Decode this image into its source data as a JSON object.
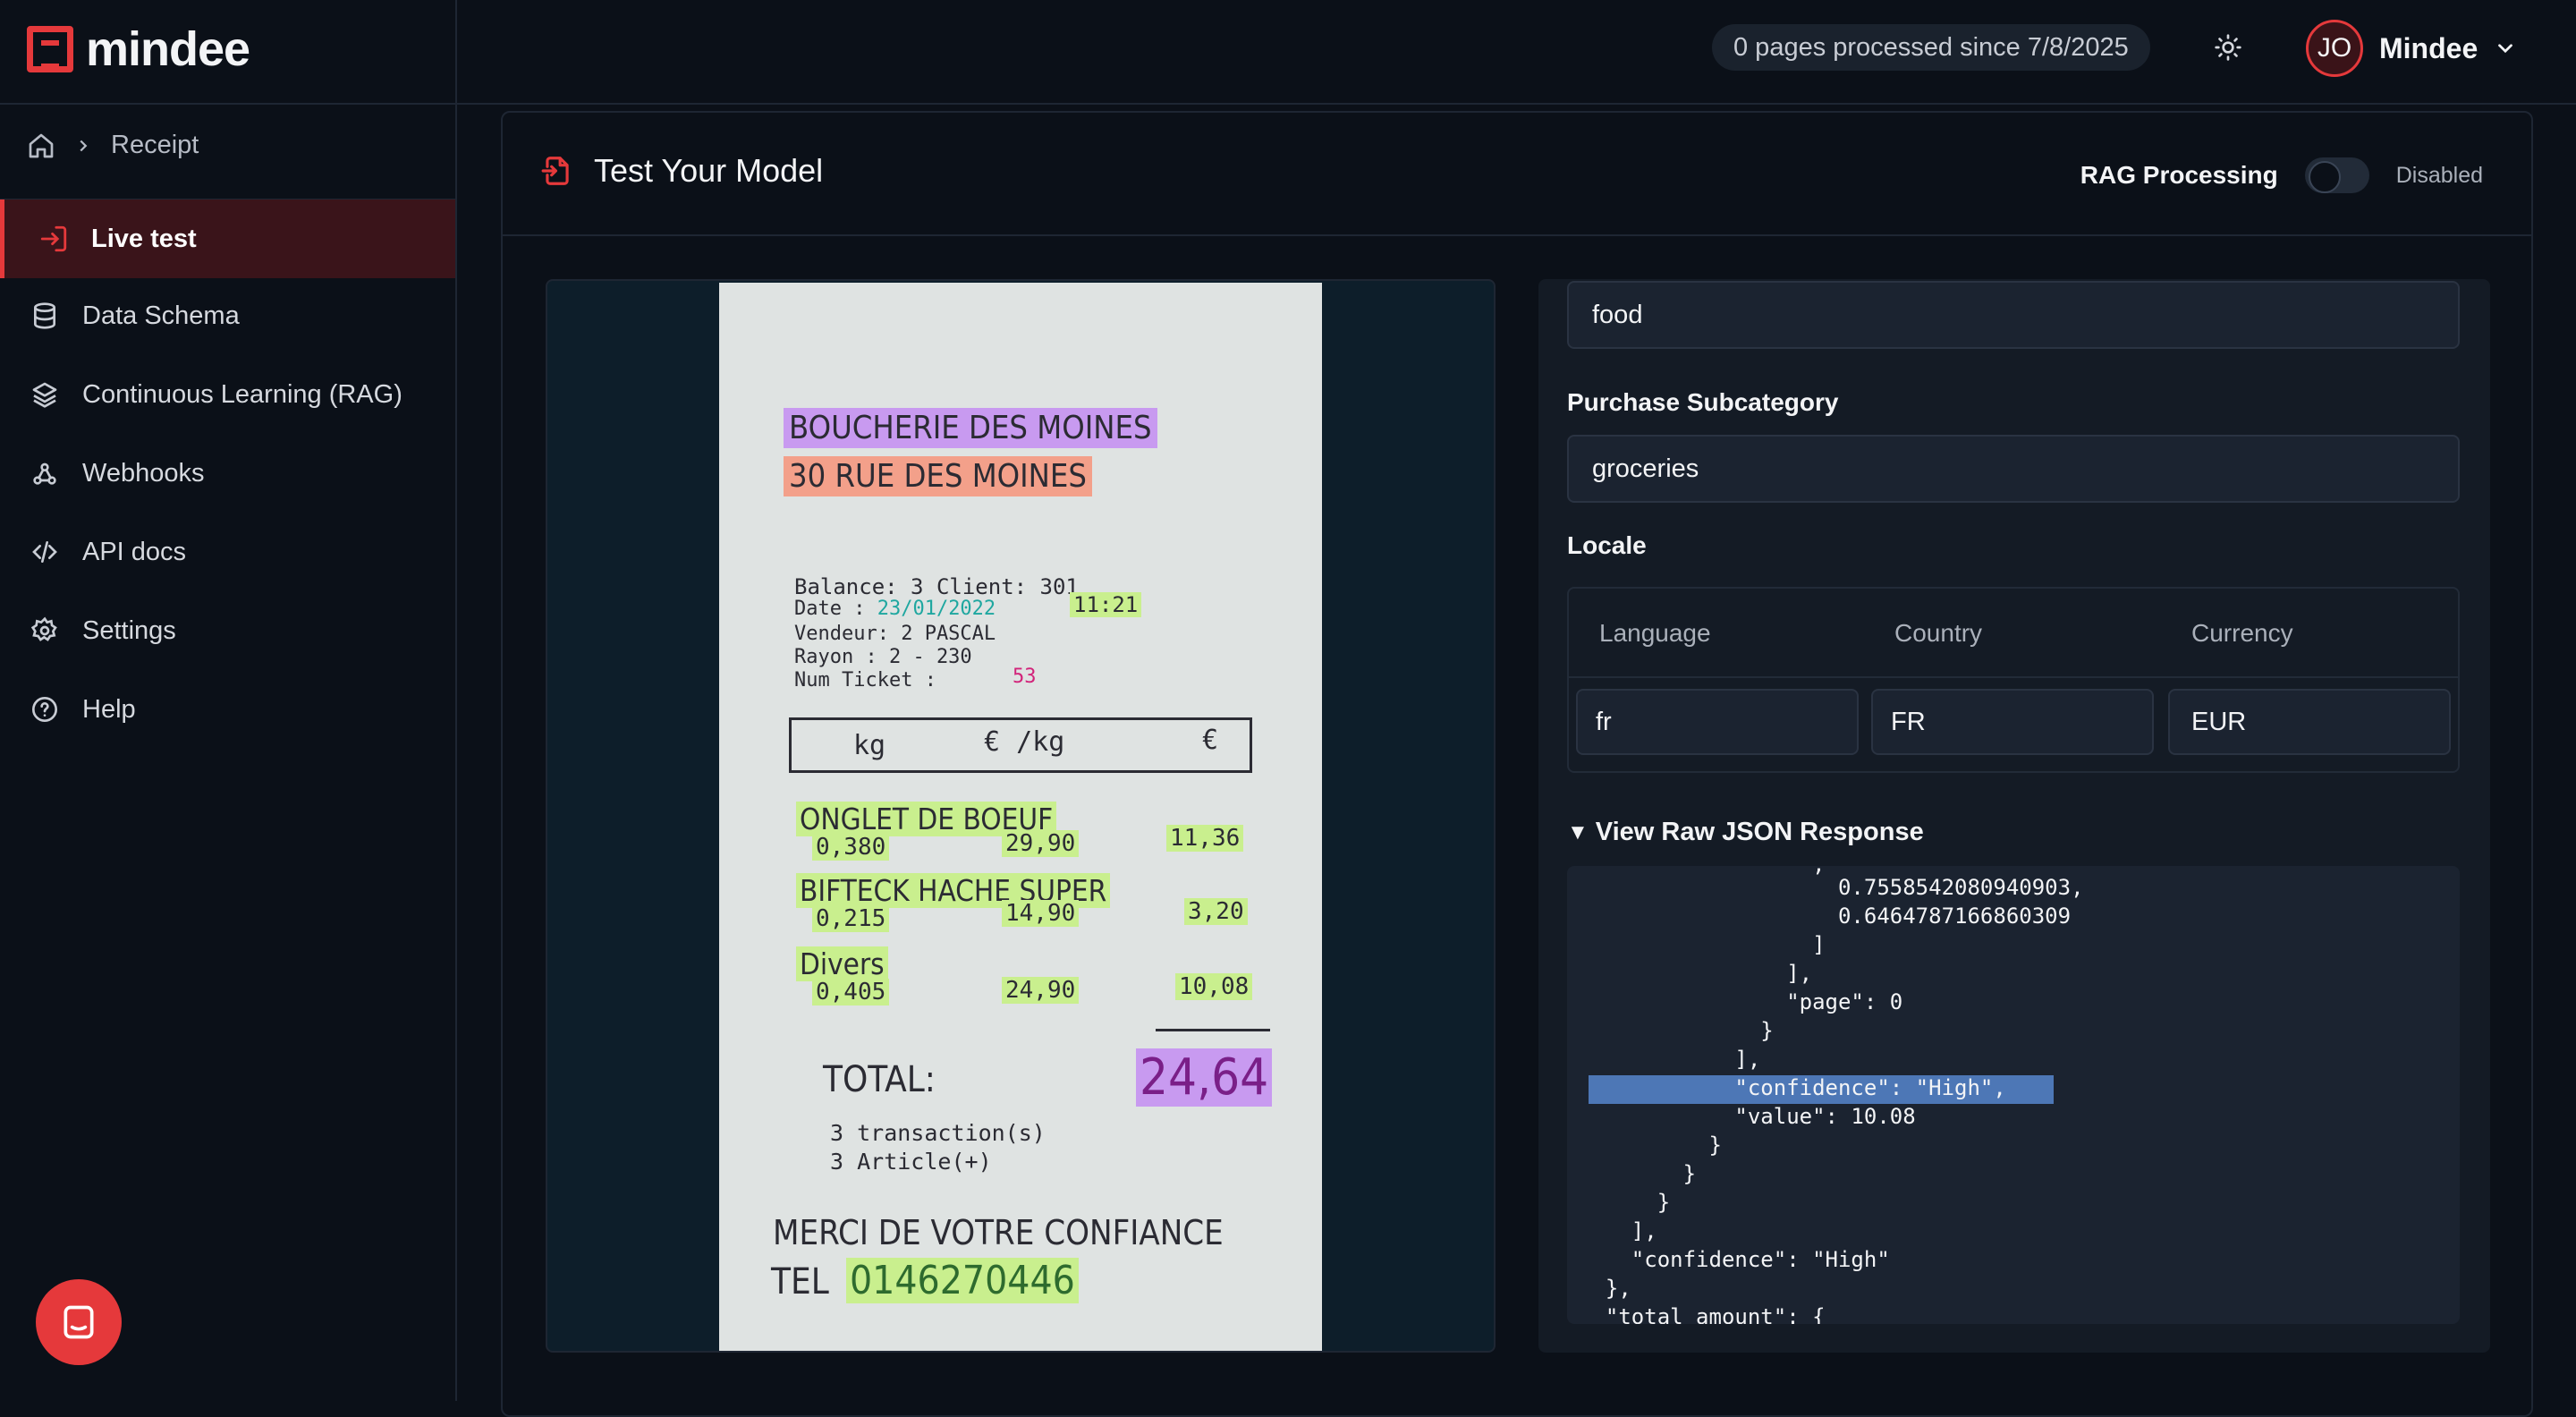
{
  "brand": {
    "name": "mindee",
    "accent": "#e5393b"
  },
  "header": {
    "pages_processed": "0 pages processed since 7/8/2025",
    "user_initials": "JO",
    "user_name": "Mindee"
  },
  "breadcrumb": {
    "current": "Receipt"
  },
  "sidebar": {
    "items": [
      {
        "label": "Live test",
        "icon": "login-arrow-icon",
        "active": true
      },
      {
        "label": "Data Schema",
        "icon": "database-icon"
      },
      {
        "label": "Continuous Learning (RAG)",
        "icon": "layers-icon"
      },
      {
        "label": "Webhooks",
        "icon": "webhook-icon"
      },
      {
        "label": "API docs",
        "icon": "code-icon"
      },
      {
        "label": "Settings",
        "icon": "gear-icon"
      },
      {
        "label": "Help",
        "icon": "help-circle-icon"
      }
    ]
  },
  "panel": {
    "title": "Test Your Model",
    "rag_label": "RAG Processing",
    "rag_state": "Disabled"
  },
  "receipt": {
    "store": "BOUCHERIE DES MOINES",
    "address": "30 RUE DES MOINES",
    "balance_line": "Balance:  3   Client:  301",
    "date_prefix": "Date : ",
    "date": "23/01/2022",
    "time": "11:21",
    "vendeur_line": "Vendeur:  2  PASCAL",
    "rayon_line": "Rayon   :  2  -  230",
    "ticket_prefix": "Num Ticket :",
    "ticket": "53",
    "col_kg": "kg",
    "col_price": "€ /kg",
    "col_eur": "€",
    "items": [
      {
        "name": "ONGLET DE BOEUF",
        "qty": "0,380",
        "unit": "29,90",
        "total": "11,36"
      },
      {
        "name": "BIFTECK HACHE SUPER",
        "qty": "0,215",
        "unit": "14,90",
        "total": "3,20"
      },
      {
        "name": "Divers",
        "qty": "0,405",
        "unit": "24,90",
        "total": "10,08"
      }
    ],
    "total_label": "TOTAL:",
    "total": "24,64",
    "transactions": "3 transaction(s)",
    "articles": "3 Article(+)",
    "thanks": "MERCI DE VOTRE CONFIANCE",
    "tel_prefix": "TEL",
    "tel": "0146270446"
  },
  "form": {
    "purchase_category_value": "food",
    "purchase_subcategory_label": "Purchase Subcategory",
    "purchase_subcategory_value": "groceries",
    "locale_label": "Locale",
    "locale": {
      "language_label": "Language",
      "language": "fr",
      "country_label": "Country",
      "country": "FR",
      "currency_label": "Currency",
      "currency": "EUR"
    }
  },
  "raw_json": {
    "summary": "View Raw JSON Response",
    "lines": [
      "                  ,",
      "                    0.7558542080940903,",
      "                    0.6464787166860309",
      "                  ]",
      "                ],",
      "                \"page\": 0",
      "              }",
      "            ],",
      "            \"confidence\": \"High\",",
      "            \"value\": 10.08",
      "          }",
      "        }",
      "      }",
      "    ],",
      "    \"confidence\": \"High\"",
      "  },",
      "  \"total_amount\": {"
    ]
  }
}
